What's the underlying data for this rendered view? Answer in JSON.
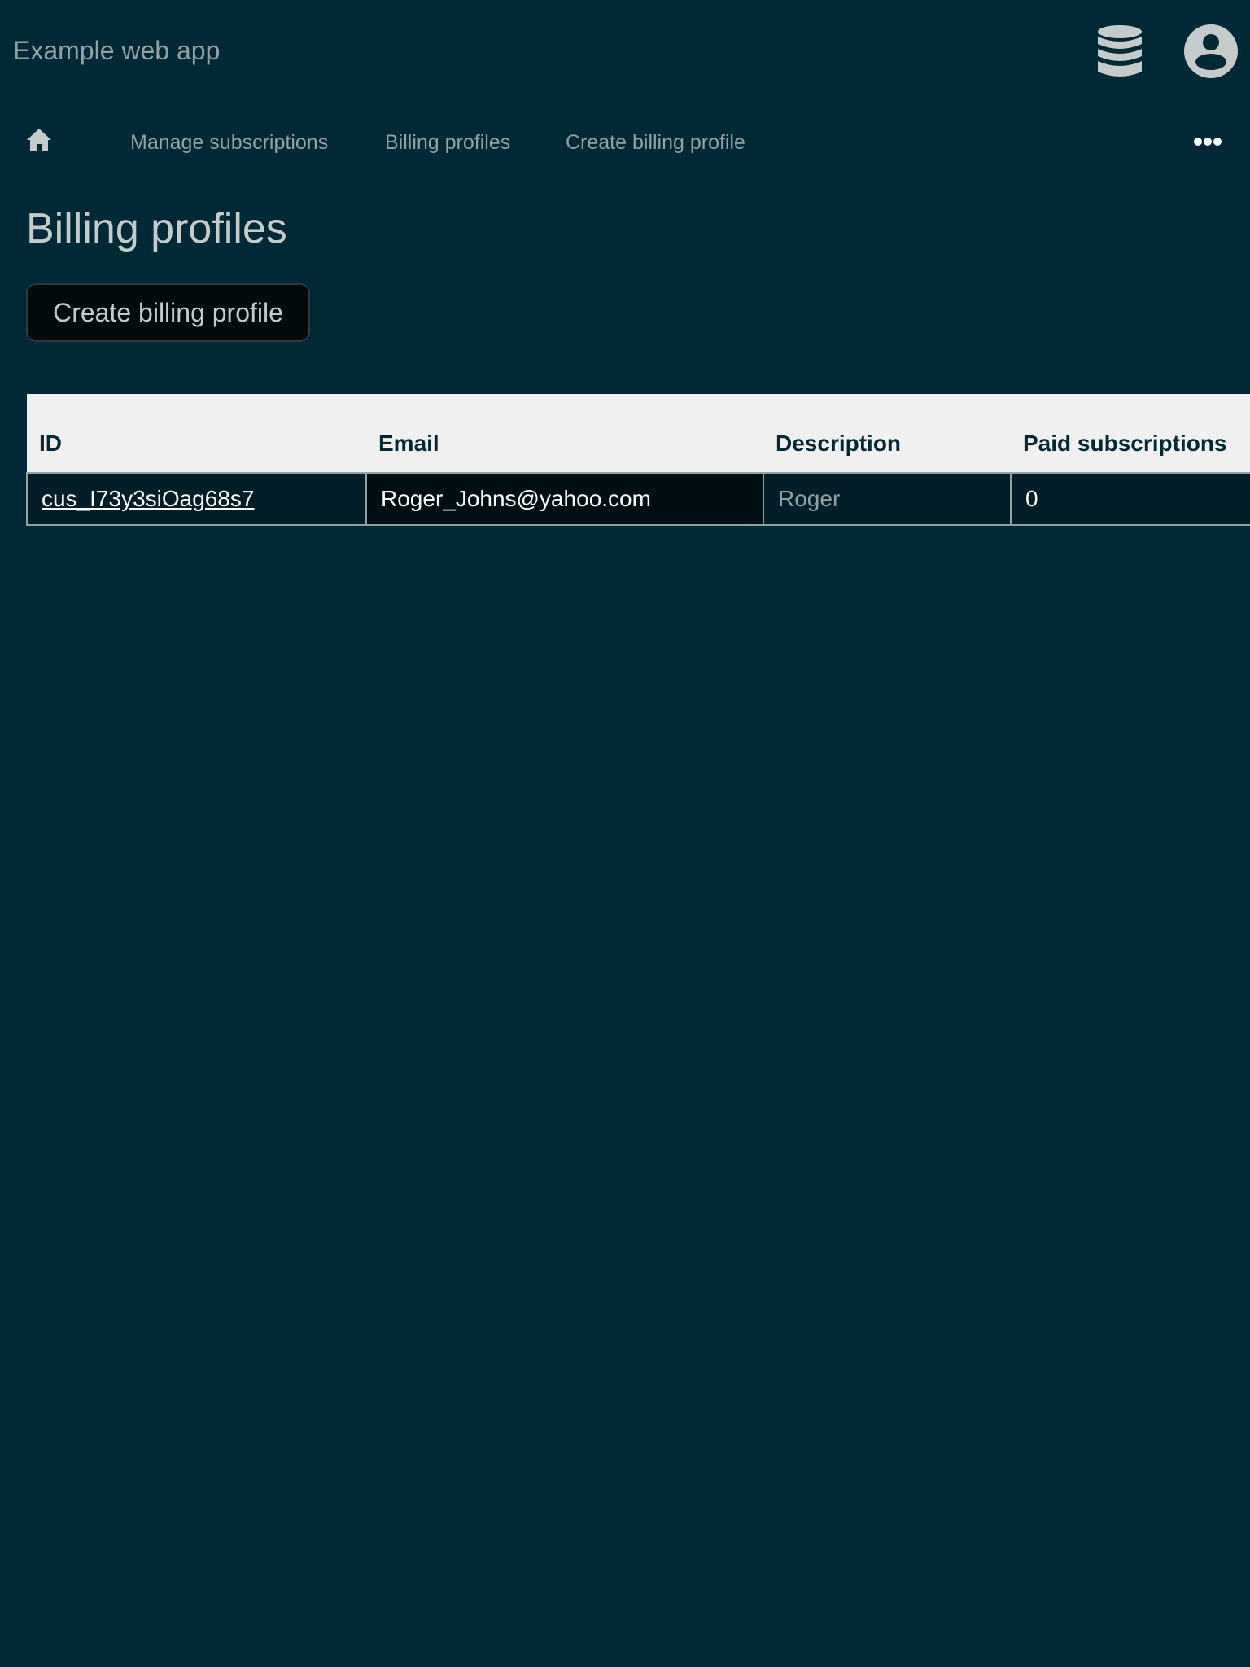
{
  "app": {
    "title": "Example web app"
  },
  "nav": {
    "items": [
      {
        "label": "Manage subscriptions"
      },
      {
        "label": "Billing profiles"
      },
      {
        "label": "Create billing profile"
      }
    ]
  },
  "page": {
    "title": "Billing profiles",
    "create_button_label": "Create billing profile"
  },
  "table": {
    "columns": [
      "ID",
      "Email",
      "Description",
      "Paid subscriptions"
    ],
    "rows": [
      {
        "id": "cus_I73y3siOag68s7",
        "email": "Roger_Johns@yahoo.com",
        "description": "Roger",
        "paid_subscriptions": "0"
      }
    ]
  },
  "icons": {
    "database": "database-icon",
    "account": "account-circle-icon",
    "home": "home-icon",
    "more": "more-horizontal-icon"
  },
  "colors": {
    "background": "#002835",
    "text_muted": "#93a1a1",
    "header_bg": "#f0f0f0"
  }
}
